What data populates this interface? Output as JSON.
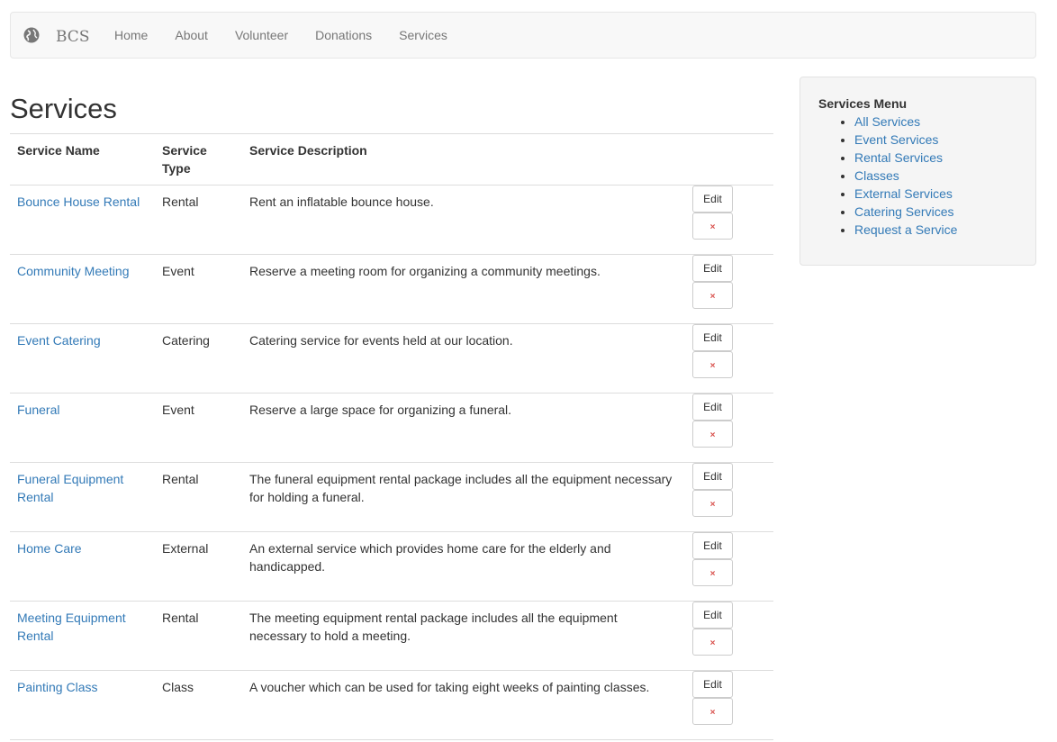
{
  "nav": {
    "brand": "BCS",
    "items": [
      "Home",
      "About",
      "Volunteer",
      "Donations",
      "Services"
    ]
  },
  "main": {
    "title": "Services",
    "headers": {
      "name": "Service Name",
      "type": "Service Type",
      "desc": "Service Description"
    },
    "edit_label": "Edit",
    "delete_label": "×",
    "rows": [
      {
        "name": "Bounce House Rental",
        "type": "Rental",
        "desc": "Rent an inflatable bounce house."
      },
      {
        "name": "Community Meeting",
        "type": "Event",
        "desc": "Reserve a meeting room for organizing a community meetings."
      },
      {
        "name": "Event Catering",
        "type": "Catering",
        "desc": "Catering service for events held at our location."
      },
      {
        "name": "Funeral",
        "type": "Event",
        "desc": "Reserve a large space for organizing a funeral."
      },
      {
        "name": "Funeral Equipment Rental",
        "type": "Rental",
        "desc": "The funeral equipment rental package includes all the equipment necessary for holding a funeral."
      },
      {
        "name": "Home Care",
        "type": "External",
        "desc": "An external service which provides home care for the elderly and handicapped."
      },
      {
        "name": "Meeting Equipment Rental",
        "type": "Rental",
        "desc": "The meeting equipment rental package includes all the equipment necessary to hold a meeting."
      },
      {
        "name": "Painting Class",
        "type": "Class",
        "desc": "A voucher which can be used for taking eight weeks of painting classes."
      }
    ]
  },
  "sidebar": {
    "title": "Services Menu",
    "items": [
      "All Services",
      "Event Services",
      "Rental Services",
      "Classes",
      "External Services",
      "Catering Services",
      "Request a Service"
    ]
  },
  "colors": {
    "link": "#337ab7",
    "delete_icon": "#d9534f",
    "navbar_bg": "#f8f8f8"
  }
}
